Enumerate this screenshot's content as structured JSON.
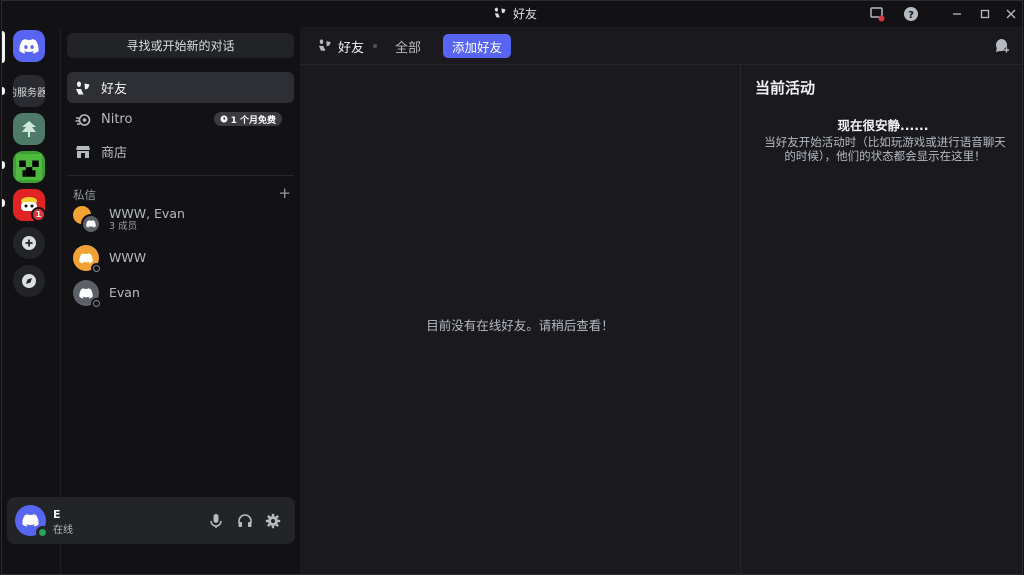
{
  "window": {
    "title": "好友"
  },
  "servers": {
    "partial_label": "的服务器",
    "notification_count": "1"
  },
  "sidebar": {
    "search_placeholder": "寻找或开始新的对话",
    "nav": [
      {
        "label": "好友"
      },
      {
        "label": "Nitro",
        "badge": "1 个月免费"
      },
      {
        "label": "商店"
      }
    ],
    "dm_header": "私信",
    "dms": [
      {
        "name": "WWW, Evan",
        "sub": "3 成员"
      },
      {
        "name": "WWW"
      },
      {
        "name": "Evan"
      }
    ]
  },
  "user": {
    "name": "E",
    "status": "在线"
  },
  "header": {
    "title": "好友",
    "tab_all": "全部",
    "add_friend": "添加好友"
  },
  "main": {
    "empty_text": "目前没有在线好友。请稍后查看！"
  },
  "activity": {
    "title": "当前活动",
    "subtitle": "现在很安静......",
    "description": "当好友开始活动时（比如玩游戏或进行语音聊天的时候），他们的状态都会显示在这里！"
  },
  "colors": {
    "brand": "#5865f2",
    "online": "#23a55a",
    "danger": "#da373c",
    "avatar_orange": "#f0a232",
    "avatar_gray": "#5c6068"
  }
}
